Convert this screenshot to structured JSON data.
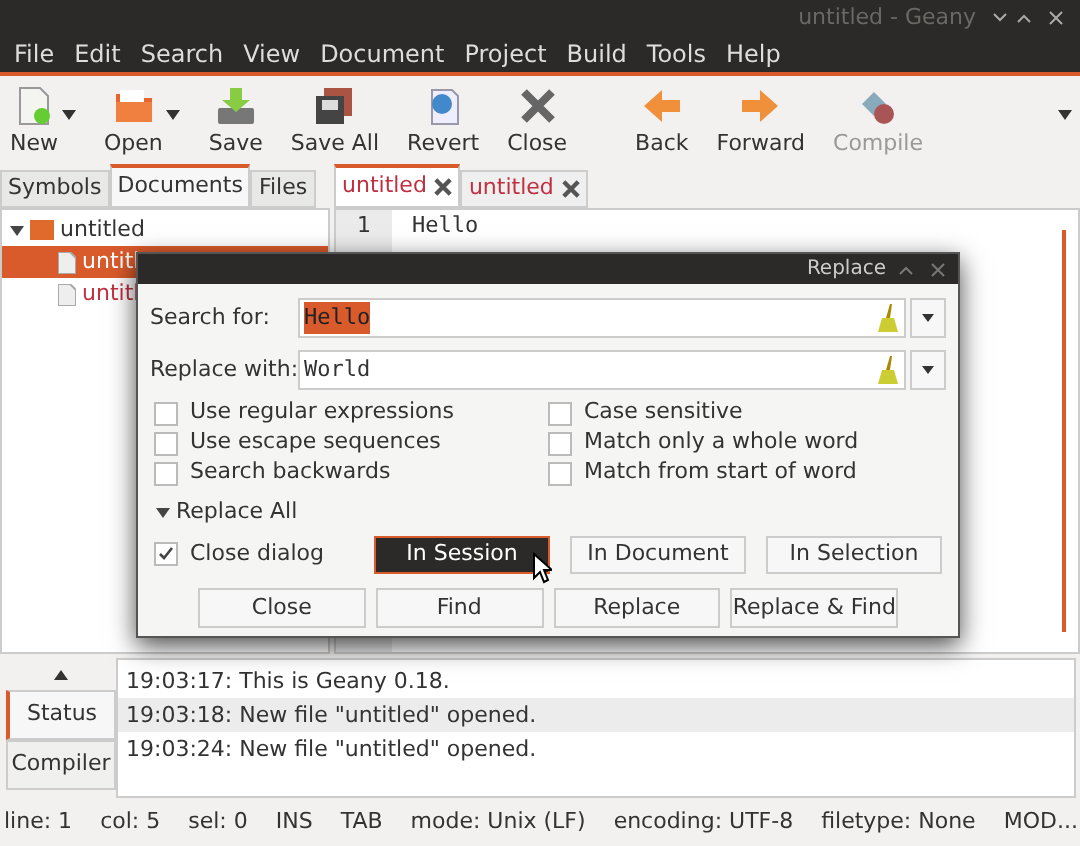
{
  "window": {
    "title": "untitled - Geany"
  },
  "menu": [
    "File",
    "Edit",
    "Search",
    "View",
    "Document",
    "Project",
    "Build",
    "Tools",
    "Help"
  ],
  "toolbar": [
    {
      "label": "New",
      "dropdown": true,
      "disabled": false
    },
    {
      "label": "Open",
      "dropdown": true,
      "disabled": false
    },
    {
      "label": "Save",
      "dropdown": false,
      "disabled": false
    },
    {
      "label": "Save All",
      "dropdown": false,
      "disabled": false
    },
    {
      "label": "Revert",
      "dropdown": false,
      "disabled": false
    },
    {
      "label": "Close",
      "dropdown": false,
      "disabled": false
    },
    {
      "label": "Back",
      "dropdown": false,
      "disabled": false
    },
    {
      "label": "Forward",
      "dropdown": false,
      "disabled": false
    },
    {
      "label": "Compile",
      "dropdown": false,
      "disabled": true
    }
  ],
  "sidebar": {
    "tabs": [
      {
        "label": "Symbols",
        "selected": false
      },
      {
        "label": "Documents",
        "selected": true
      },
      {
        "label": "Files",
        "selected": false
      }
    ],
    "tree": [
      {
        "label": "untitled",
        "expanded": true,
        "children": [
          {
            "label": "untitl",
            "selected": true
          },
          {
            "label": "untitl",
            "selected": false
          }
        ]
      }
    ]
  },
  "editor": {
    "tabs": [
      {
        "label": "untitled",
        "selected": true
      },
      {
        "label": "untitled",
        "selected": false
      }
    ],
    "lines": [
      {
        "number": "1",
        "text": "Hello"
      }
    ]
  },
  "dialog": {
    "title": "Replace",
    "search_for": {
      "label": "Search for:",
      "value": "Hello"
    },
    "replace_with": {
      "label": "Replace with:",
      "value": "World"
    },
    "options_left": [
      {
        "label": "Use regular expressions",
        "checked": false
      },
      {
        "label": "Use escape sequences",
        "checked": false
      },
      {
        "label": "Search backwards",
        "checked": false
      }
    ],
    "options_right": [
      {
        "label": "Case sensitive",
        "checked": false
      },
      {
        "label": "Match only a whole word",
        "checked": false
      },
      {
        "label": "Match from start of word",
        "checked": false
      }
    ],
    "replace_all": {
      "label": "Replace All",
      "expanded": true
    },
    "close_dialog": {
      "label": "Close dialog",
      "checked": true
    },
    "scope_buttons": [
      {
        "label": "In Session",
        "selected": true
      },
      {
        "label": "In Document",
        "selected": false
      },
      {
        "label": "In Selection",
        "selected": false
      }
    ],
    "buttons": [
      "Close",
      "Find",
      "Replace",
      "Replace & Find"
    ]
  },
  "messages": {
    "tabs": [
      {
        "label": "Status",
        "selected": true
      },
      {
        "label": "Compiler",
        "selected": false
      }
    ],
    "lines": [
      {
        "text": "19:03:17: This is Geany 0.18.",
        "selected": false
      },
      {
        "text": "19:03:18: New file \"untitled\" opened.",
        "selected": true
      },
      {
        "text": "19:03:24: New file \"untitled\" opened.",
        "selected": false
      }
    ]
  },
  "status_bar": [
    "line: 1",
    "col: 5",
    "sel: 0",
    "INS",
    "TAB",
    "mode: Unix (LF)",
    "encoding: UTF-8",
    "filetype: None",
    "MOD..."
  ]
}
